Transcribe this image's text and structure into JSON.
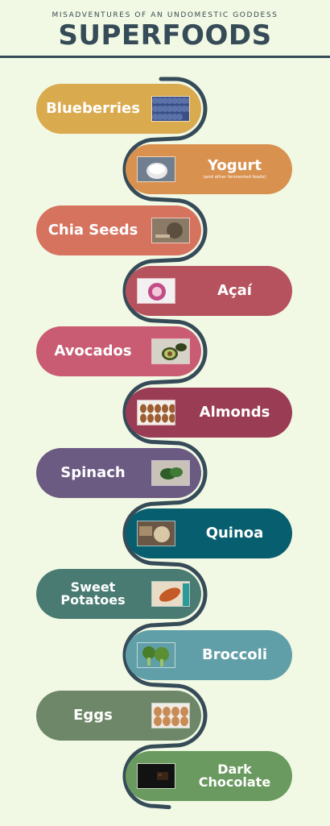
{
  "header": {
    "subtitle": "MISADVENTURES OF AN UNDOMESTIC GODDESS",
    "title": "SUPERFOODS"
  },
  "colors": {
    "background": "#f1f8e4",
    "track": "#364b58"
  },
  "items": [
    {
      "label": "Blueberries",
      "sub": "",
      "color": "#d9aa4e",
      "image": "blueberries-photo"
    },
    {
      "label": "Yogurt",
      "sub": "(and other fermented foods)",
      "color": "#d99150",
      "image": "yogurt-photo"
    },
    {
      "label": "Chia Seeds",
      "sub": "",
      "color": "#d6735f",
      "image": "chia-seeds-photo"
    },
    {
      "label": "Açaí",
      "sub": "",
      "color": "#b5525d",
      "image": "acai-bowl-photo"
    },
    {
      "label": "Avocados",
      "sub": "",
      "color": "#c95c73",
      "image": "avocado-photo"
    },
    {
      "label": "Almonds",
      "sub": "",
      "color": "#9a3c54",
      "image": "almonds-photo"
    },
    {
      "label": "Spinach",
      "sub": "",
      "color": "#6b5a82",
      "image": "spinach-photo"
    },
    {
      "label": "Quinoa",
      "sub": "",
      "color": "#075e6e",
      "image": "quinoa-photo"
    },
    {
      "label": "Sweet Potatoes",
      "sub": "",
      "color": "#497b73",
      "image": "sweet-potatoes-photo"
    },
    {
      "label": "Broccoli",
      "sub": "",
      "color": "#609fa7",
      "image": "broccoli-photo"
    },
    {
      "label": "Eggs",
      "sub": "",
      "color": "#6e8768",
      "image": "eggs-photo"
    },
    {
      "label": "Dark Chocolate",
      "sub": "",
      "color": "#6a9a5f",
      "image": "dark-chocolate-photo"
    }
  ]
}
